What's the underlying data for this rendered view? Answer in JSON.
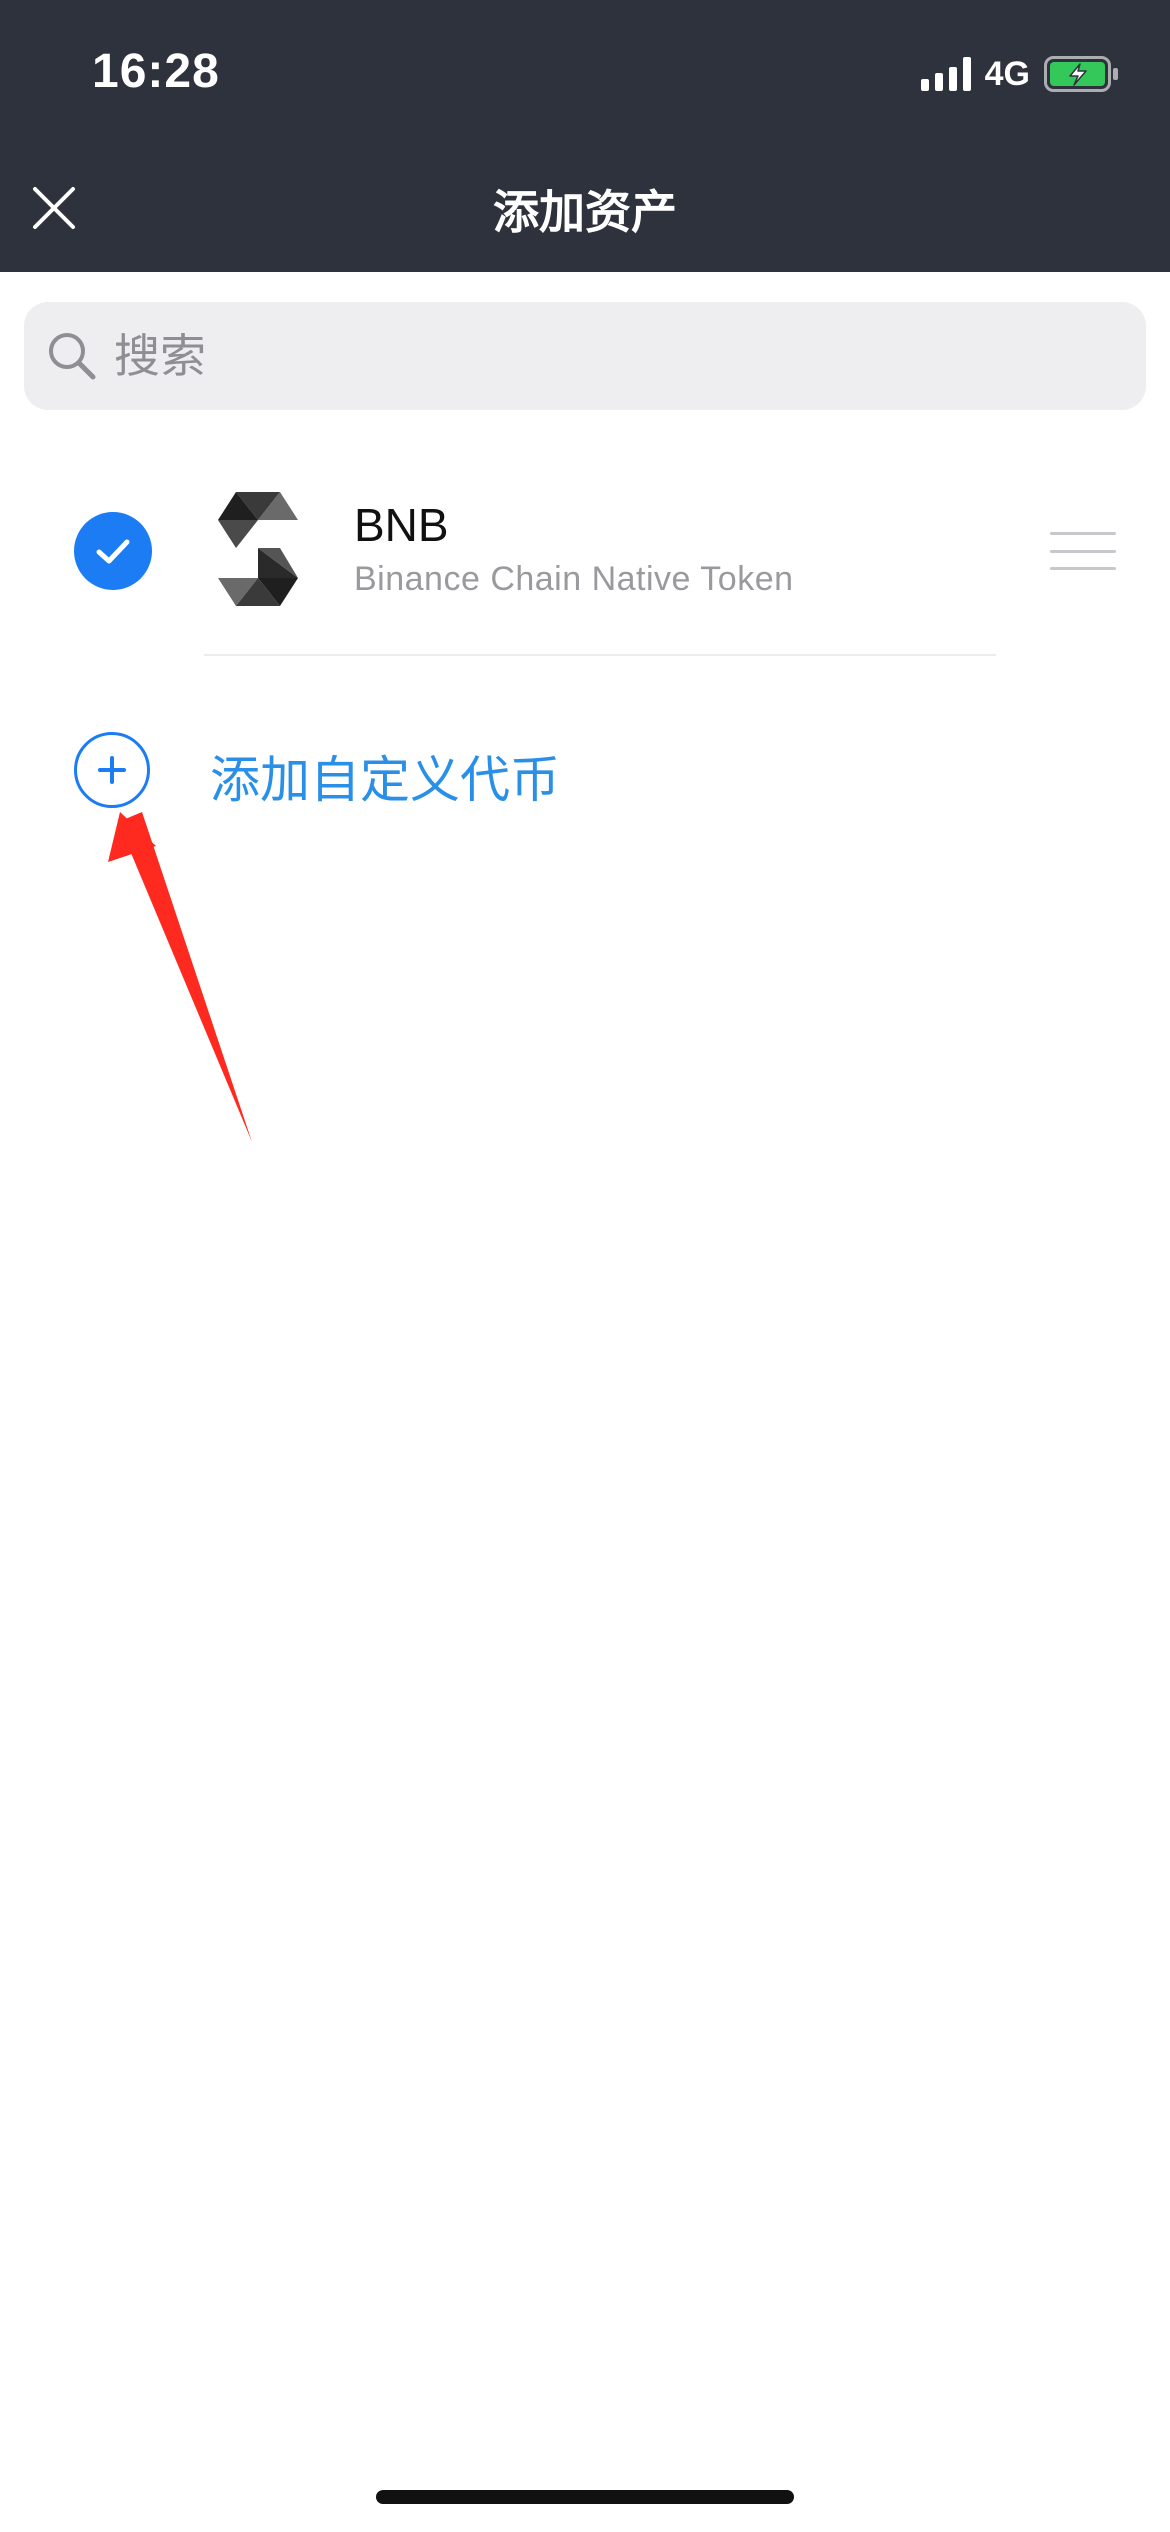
{
  "status_bar": {
    "time": "16:28",
    "network": "4G",
    "battery_charging": true,
    "battery_color": "#34c759"
  },
  "nav": {
    "title": "添加资产",
    "close_icon": "close-icon"
  },
  "search": {
    "placeholder": "搜索",
    "value": ""
  },
  "tokens": [
    {
      "selected": true,
      "symbol": "BNB",
      "name": "Binance Chain Native Token",
      "logo_icon": "token-logo-icon"
    }
  ],
  "add_custom": {
    "label": "添加自定义代币",
    "icon": "plus-circle-icon",
    "color": "#1b7cf3"
  },
  "colors": {
    "header_bg": "#2e323c",
    "accent": "#1b7cf3",
    "annotation_arrow": "#ff2a1f"
  }
}
